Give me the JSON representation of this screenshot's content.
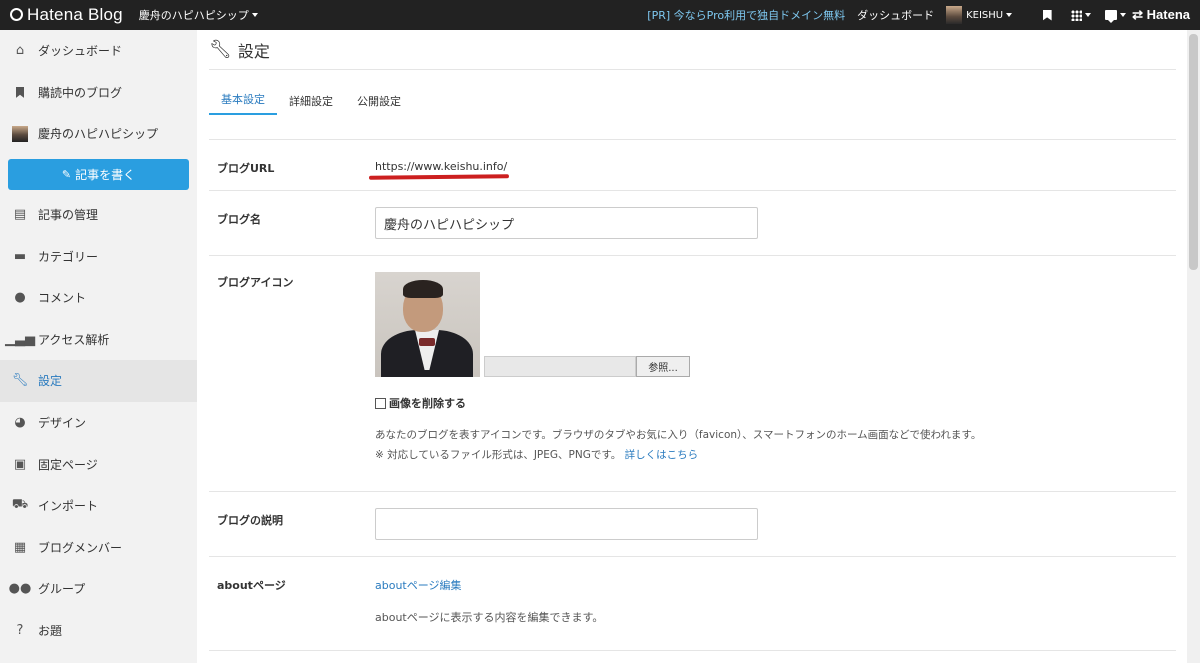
{
  "topbar": {
    "brand": "Hatena Blog",
    "blog_title": "慶舟のハピハピシップ",
    "promo": "[PR] 今ならPro利用で独自ドメイン無料",
    "dashboard": "ダッシュボード",
    "user": "KEISHU",
    "hatena": "Hatena"
  },
  "sidebar": {
    "items": [
      {
        "label": "ダッシュボード",
        "icon": "home-icon"
      },
      {
        "label": "購読中のブログ",
        "icon": "bookmark-icon"
      },
      {
        "label": "慶舟のハピハピシップ",
        "icon": "avatar"
      },
      {
        "label": "記事の管理",
        "icon": "document-icon"
      },
      {
        "label": "カテゴリー",
        "icon": "folder-icon"
      },
      {
        "label": "コメント",
        "icon": "comment-icon"
      },
      {
        "label": "アクセス解析",
        "icon": "signal-icon"
      },
      {
        "label": "設定",
        "icon": "wrench-icon"
      },
      {
        "label": "デザイン",
        "icon": "palette-icon"
      },
      {
        "label": "固定ページ",
        "icon": "page-icon"
      },
      {
        "label": "インポート",
        "icon": "truck-icon"
      },
      {
        "label": "ブログメンバー",
        "icon": "id-card-icon"
      },
      {
        "label": "グループ",
        "icon": "group-icon"
      },
      {
        "label": "お題",
        "icon": "question-icon"
      }
    ],
    "write_button": "記事を書く",
    "active_index": 7
  },
  "main": {
    "title": "設定",
    "tabs": [
      "基本設定",
      "詳細設定",
      "公開設定"
    ],
    "active_tab": 0,
    "rows": {
      "url_label": "ブログURL",
      "url_value": "https://www.keishu.info/",
      "name_label": "ブログ名",
      "name_value": "慶舟のハピハピシップ",
      "icon_label": "ブログアイコン",
      "browse_button": "参照...",
      "delete_image": "画像を削除する",
      "icon_desc_1": "あなたのブログを表すアイコンです。ブラウザのタブやお気に入り（favicon）、スマートフォンのホーム画面などで使われます。",
      "icon_desc_2": "※ 対応しているファイル形式は、JPEG、PNGです。",
      "icon_desc_link": "詳しくはこちら",
      "desc_label": "ブログの説明",
      "desc_value": "",
      "about_label": "aboutページ",
      "about_link": "aboutページ編集",
      "about_desc": "aboutページに表示する内容を編集できます。"
    }
  },
  "colors": {
    "topbar": "#222222",
    "accent": "#2a9ee0",
    "link": "#2a7bbf",
    "underline_mark": "#cc1f1f"
  }
}
